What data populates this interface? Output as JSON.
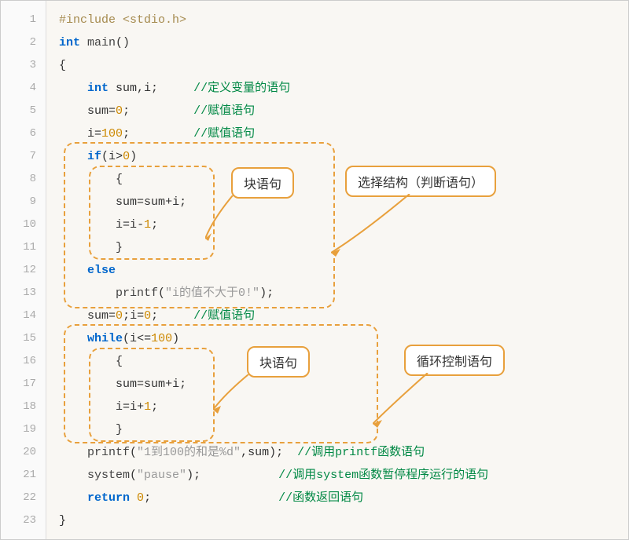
{
  "lines": {
    "1": "1",
    "2": "2",
    "3": "3",
    "4": "4",
    "5": "5",
    "6": "6",
    "7": "7",
    "8": "8",
    "9": "9",
    "10": "10",
    "11": "11",
    "12": "12",
    "13": "13",
    "14": "14",
    "15": "15",
    "16": "16",
    "17": "17",
    "18": "18",
    "19": "19",
    "20": "20",
    "21": "21",
    "22": "22",
    "23": "23"
  },
  "code": {
    "l1a": "#include <stdio.h>",
    "l2_int": "int",
    "l2_main": " main",
    "l2_par": "()",
    "l3": "{",
    "l4_ind": "    ",
    "l4_int": "int",
    "l4_rest": " sum,i;     ",
    "l4_c": "//定义变量的语句",
    "l5_ind": "    ",
    "l5_a": "sum",
    "l5_eq": "=",
    "l5_n": "0",
    "l5_sc": ";         ",
    "l5_c": "//赋值语句",
    "l6_ind": "    ",
    "l6_a": "i",
    "l6_eq": "=",
    "l6_n": "100",
    "l6_sc": ";         ",
    "l6_c": "//赋值语句",
    "l7_ind": "    ",
    "l7_if": "if",
    "l7_p1": "(",
    "l7_i": "i",
    "l7_op": ">",
    "l7_n": "0",
    "l7_p2": ")",
    "l8_ind": "        ",
    "l8_b": "{",
    "l9_ind": "        ",
    "l9_a": "sum",
    "l9_eq": "=",
    "l9_b": "sum",
    "l9_op": "+",
    "l9_c2": "i",
    "l9_sc": ";",
    "l10_ind": "        ",
    "l10_a": "i",
    "l10_eq": "=",
    "l10_b": "i",
    "l10_op": "-",
    "l10_n": "1",
    "l10_sc": ";",
    "l11_ind": "        ",
    "l11_b": "}",
    "l12_ind": "    ",
    "l12_else": "else",
    "l13_ind": "        ",
    "l13_fn": "printf",
    "l13_p1": "(",
    "l13_str": "\"i的值不大于0!\"",
    "l13_p2": ");",
    "l14_ind": "    ",
    "l14_a": "sum",
    "l14_eq": "=",
    "l14_n": "0",
    "l14_sc": ";",
    "l14_a2": "i",
    "l14_eq2": "=",
    "l14_n2": "0",
    "l14_sc2": ";     ",
    "l14_c": "//赋值语句",
    "l15_ind": "    ",
    "l15_w": "while",
    "l15_p1": "(",
    "l15_i": "i",
    "l15_op": "<=",
    "l15_n": "100",
    "l15_p2": ")",
    "l16_ind": "        ",
    "l16_b": "{",
    "l17_ind": "        ",
    "l17_a": "sum",
    "l17_eq": "=",
    "l17_b": "sum",
    "l17_op": "+",
    "l17_c2": "i",
    "l17_sc": ";",
    "l18_ind": "        ",
    "l18_a": "i",
    "l18_eq": "=",
    "l18_b": "i",
    "l18_op": "+",
    "l18_n": "1",
    "l18_sc": ";",
    "l19_ind": "        ",
    "l19_b": "}",
    "l20_ind": "    ",
    "l20_fn": "printf",
    "l20_p1": "(",
    "l20_str": "\"1到100的和是%d\"",
    "l20_c": ",sum);  ",
    "l20_cm": "//调用printf函数语句",
    "l21_ind": "    ",
    "l21_fn": "system",
    "l21_p1": "(",
    "l21_str": "\"pause\"",
    "l21_p2": ");           ",
    "l21_cm": "//调用system函数暂停程序运行的语句",
    "l22_ind": "    ",
    "l22_ret": "return",
    "l22_sp": " ",
    "l22_n": "0",
    "l22_sc": ";                  ",
    "l22_cm": "//函数返回语句",
    "l23": "}"
  },
  "callouts": {
    "block1": "块语句",
    "select": "选择结构（判断语句）",
    "block2": "块语句",
    "loop": "循环控制语句"
  }
}
